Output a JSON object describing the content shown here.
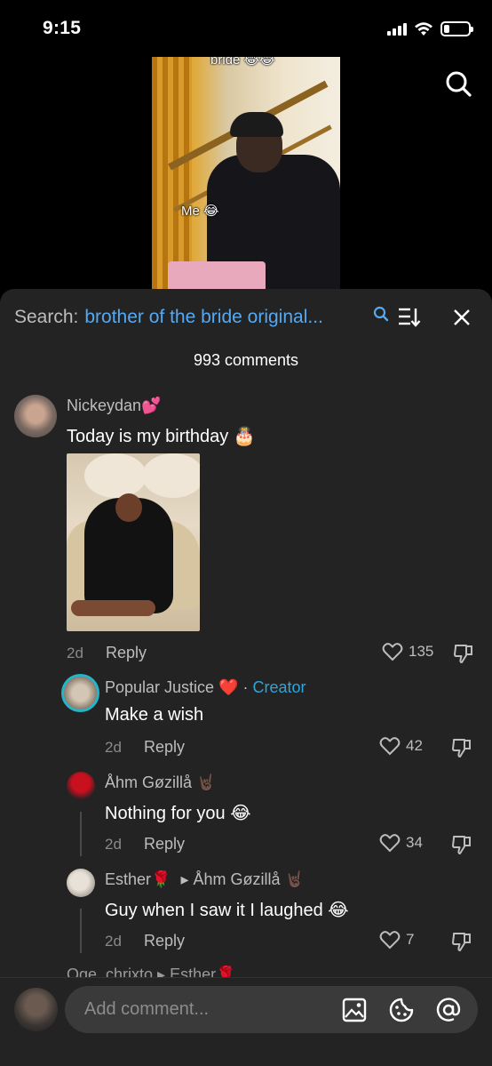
{
  "status": {
    "time": "9:15"
  },
  "video": {
    "caption_top": "bride 😂😂",
    "caption_me": "Me 😂"
  },
  "header": {
    "search_prefix": "Search:",
    "search_query": "brother of the bride original...",
    "comment_count": "993 comments"
  },
  "comments": [
    {
      "username": "Nickeydan💕",
      "text": "Today is my birthday 🎂",
      "age": "2d",
      "reply_label": "Reply",
      "likes": "135"
    }
  ],
  "replies": [
    {
      "username": "Popular Justice ❤️",
      "badge_sep": "·",
      "badge": "Creator",
      "text": "Make a wish",
      "age": "2d",
      "reply_label": "Reply",
      "likes": "42"
    },
    {
      "username": "Åhm Gøzillå 🤘🏿",
      "text": "Nothing for you 😂",
      "age": "2d",
      "reply_label": "Reply",
      "likes": "34"
    },
    {
      "username": "Esther🌹",
      "reply_to": "▸ Åhm Gøzillå 🤘🏿",
      "text": "Guy when I saw it I laughed 😂",
      "age": "2d",
      "reply_label": "Reply",
      "likes": "7"
    }
  ],
  "partial_next": "Oge_chrixto ▸ Esther🌹",
  "composer": {
    "placeholder": "Add comment..."
  },
  "colors": {
    "accent_blue": "#55a9f2",
    "creator_blue": "#2ca6de",
    "sheet_bg": "#232323"
  }
}
